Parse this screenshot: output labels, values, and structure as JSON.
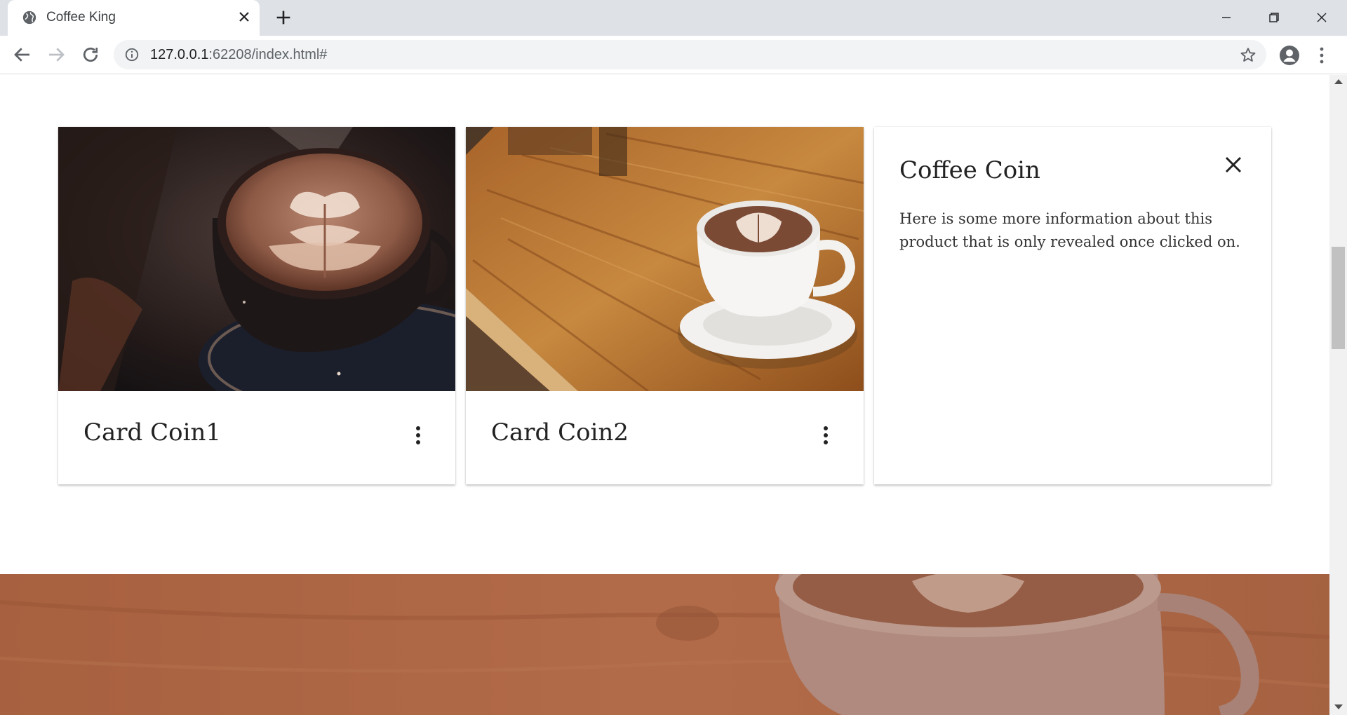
{
  "browser": {
    "tab_title": "Coffee King",
    "url_host": "127.0.0.1",
    "url_rest": ":62208/index.html#"
  },
  "cards": [
    {
      "title": "Card Coin1",
      "image": "latte-art-dark-cup-photo",
      "menu_icon": "more-vert-icon"
    },
    {
      "title": "Card Coin2",
      "image": "latte-on-wooden-table-photo",
      "menu_icon": "more-vert-icon"
    }
  ],
  "reveal_card": {
    "title": "Coffee Coin",
    "text": "Here is some more information about this product that is only revealed once clicked on.",
    "close_icon": "close-icon"
  },
  "parallax": {
    "image": "coffee-cup-parallax-photo"
  },
  "colors": {
    "tabbar": "#dee1e6",
    "omnibox": "#f1f3f4",
    "parallax_tint": "#a8664a"
  }
}
